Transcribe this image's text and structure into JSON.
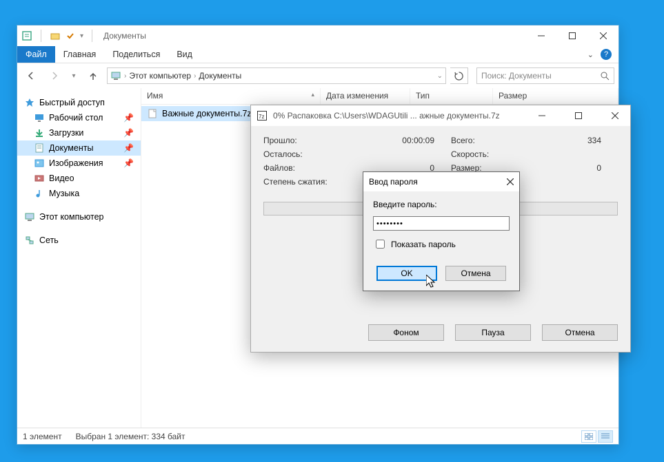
{
  "explorer": {
    "window_title": "Документы",
    "ribbon": {
      "file": "Файл",
      "home": "Главная",
      "share": "Поделиться",
      "view": "Вид"
    },
    "breadcrumb": {
      "root": "Этот компьютер",
      "folder": "Документы"
    },
    "search_placeholder": "Поиск: Документы",
    "nav": {
      "quick_access": "Быстрый доступ",
      "desktop": "Рабочий стол",
      "downloads": "Загрузки",
      "documents": "Документы",
      "pictures": "Изображения",
      "videos": "Видео",
      "music": "Музыка",
      "this_pc": "Этот компьютер",
      "network": "Сеть"
    },
    "columns": {
      "name": "Имя",
      "date": "Дата изменения",
      "type": "Тип",
      "size": "Размер"
    },
    "file": {
      "name": "Важные документы.7z"
    },
    "status": {
      "count": "1 элемент",
      "selection": "Выбран 1 элемент: 334 байт"
    }
  },
  "progress": {
    "title": "0% Распаковка C:\\Users\\WDAGUtili ... ажные документы.7z",
    "labels": {
      "elapsed": "Прошло:",
      "remaining": "Осталось:",
      "files": "Файлов:",
      "ratio": "Степень сжатия:",
      "total": "Всего:",
      "speed": "Скорость:",
      "size": "Размер:"
    },
    "values": {
      "elapsed": "00:00:09",
      "files": "0",
      "total": "334",
      "size": "0"
    },
    "buttons": {
      "background": "Фоном",
      "pause": "Пауза",
      "cancel": "Отмена"
    }
  },
  "password_dialog": {
    "title": "Ввод пароля",
    "prompt": "Введите пароль:",
    "value_masked": "••••••••",
    "show_password": "Показать пароль",
    "ok": "OK",
    "cancel": "Отмена"
  }
}
